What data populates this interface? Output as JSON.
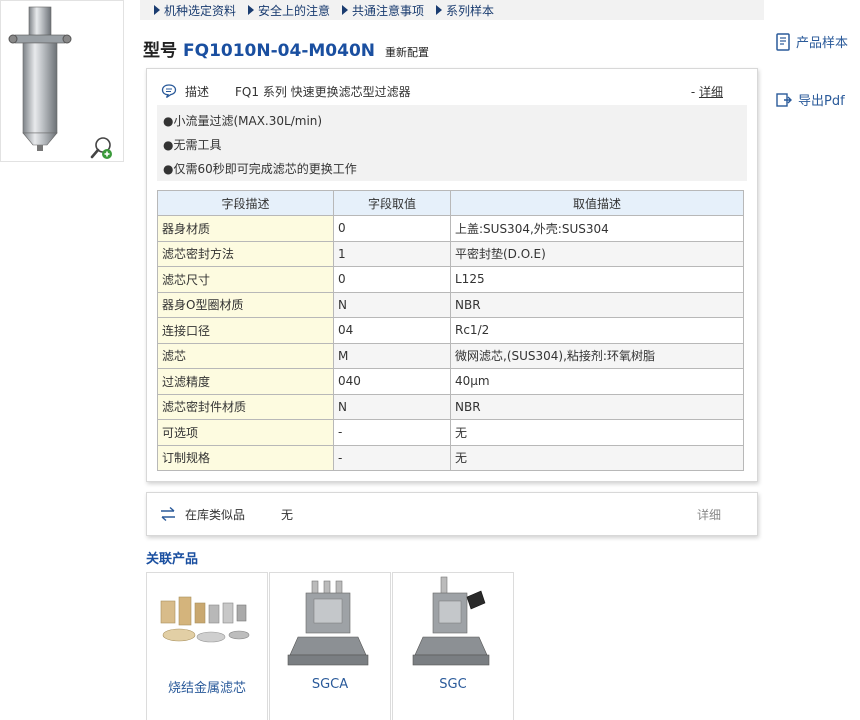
{
  "nav": {
    "items": [
      {
        "label": "机种选定资料"
      },
      {
        "label": "安全上的注意"
      },
      {
        "label": "共通注意事项"
      },
      {
        "label": "系列样本"
      }
    ]
  },
  "tools": {
    "catalog_label": "产品样本",
    "pdf_label": "导出Pdf"
  },
  "model": {
    "label": "型号",
    "code": "FQ1010N-04-M040N",
    "reconfig_label": "重新配置"
  },
  "description": {
    "label": "描述",
    "summary": "FQ1 系列 快速更换滤芯型过滤器",
    "detail_prefix": "-",
    "detail_label": "详细",
    "features": [
      "●小流量过滤(MAX.30L/min)",
      "●无需工具",
      "●仅需60秒即可完成滤芯的更换工作"
    ]
  },
  "spec_table": {
    "headers": [
      "字段描述",
      "字段取值",
      "取值描述"
    ],
    "rows": [
      {
        "field": "器身材质",
        "value": "0",
        "desc": "上盖:SUS304,外壳:SUS304"
      },
      {
        "field": "滤芯密封方法",
        "value": "1",
        "desc": "平密封垫(D.O.E)"
      },
      {
        "field": "滤芯尺寸",
        "value": "0",
        "desc": "L125"
      },
      {
        "field": "器身O型圈材质",
        "value": "N",
        "desc": "NBR"
      },
      {
        "field": "连接口径",
        "value": "04",
        "desc": "Rc1/2"
      },
      {
        "field": "滤芯",
        "value": "M",
        "desc": "微网滤芯,(SUS304),粘接剂:环氧树脂"
      },
      {
        "field": "过滤精度",
        "value": "040",
        "desc": "40μm"
      },
      {
        "field": "滤芯密封件材质",
        "value": "N",
        "desc": "NBR"
      },
      {
        "field": "可选项",
        "value": "-",
        "desc": "无"
      },
      {
        "field": "订制规格",
        "value": "-",
        "desc": "无"
      }
    ]
  },
  "stock": {
    "label": "在库类似品",
    "value": "无",
    "detail_label": "详细"
  },
  "related": {
    "title": "关联产品",
    "items": [
      {
        "caption": "烧结金属滤芯"
      },
      {
        "caption": "SGCA"
      },
      {
        "caption": "SGC"
      }
    ]
  },
  "colors": {
    "accent": "#1a4fa0",
    "link": "#2a5a9a",
    "header_bg": "#e6f0fa",
    "field_bg": "#fdfbe0"
  }
}
